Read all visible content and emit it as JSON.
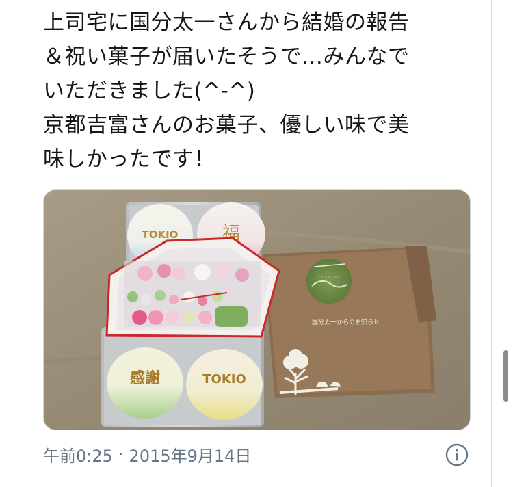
{
  "tweet": {
    "lines": [
      "上司宅に国分太一さんから結婚の報告",
      "＆祝い菓子が届いたそうで…みんなで",
      "いただきました(^-^)",
      "京都吉富さんのお菓子、優しい味で美",
      "味しかったです！"
    ]
  },
  "photo": {
    "cake_labels": [
      "TOKIO",
      "福",
      "感謝",
      "TOKIO"
    ],
    "card_caption": "国分太一からのお知らせ"
  },
  "meta": {
    "time": "午前0:25",
    "separator": "·",
    "date": "2015年9月14日"
  },
  "icons": {
    "info": "info-icon"
  },
  "colors": {
    "text": "#14171a",
    "meta": "#657786",
    "border": "#ccd6dd"
  }
}
